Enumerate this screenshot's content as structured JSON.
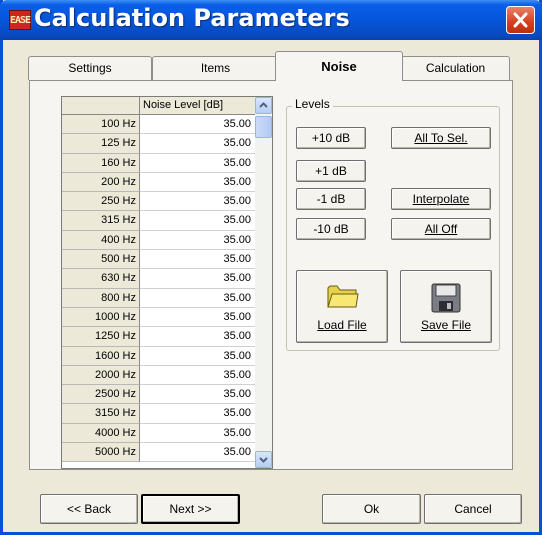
{
  "window": {
    "title": "Calculation Parameters"
  },
  "tabs": [
    {
      "label": "Settings"
    },
    {
      "label": "Items"
    },
    {
      "label": "Noise"
    },
    {
      "label": "Calculation"
    }
  ],
  "grid": {
    "column_header": "Noise Level [dB]",
    "rows": [
      {
        "freq": "100 Hz",
        "value": "35.00"
      },
      {
        "freq": "125 Hz",
        "value": "35.00"
      },
      {
        "freq": "160 Hz",
        "value": "35.00"
      },
      {
        "freq": "200 Hz",
        "value": "35.00"
      },
      {
        "freq": "250 Hz",
        "value": "35.00"
      },
      {
        "freq": "315 Hz",
        "value": "35.00"
      },
      {
        "freq": "400 Hz",
        "value": "35.00"
      },
      {
        "freq": "500 Hz",
        "value": "35.00"
      },
      {
        "freq": "630 Hz",
        "value": "35.00"
      },
      {
        "freq": "800 Hz",
        "value": "35.00"
      },
      {
        "freq": "1000 Hz",
        "value": "35.00"
      },
      {
        "freq": "1250 Hz",
        "value": "35.00"
      },
      {
        "freq": "1600 Hz",
        "value": "35.00"
      },
      {
        "freq": "2000 Hz",
        "value": "35.00"
      },
      {
        "freq": "2500 Hz",
        "value": "35.00"
      },
      {
        "freq": "3150 Hz",
        "value": "35.00"
      },
      {
        "freq": "4000 Hz",
        "value": "35.00"
      },
      {
        "freq": "5000 Hz",
        "value": "35.00"
      }
    ]
  },
  "levels": {
    "label": "Levels",
    "plus10": "+10 dB",
    "plus1": "+1 dB",
    "minus1": "-1 dB",
    "minus10": "-10 dB",
    "all_to_sel": "All To Sel.",
    "interpolate": "Interpolate",
    "all_off": "All Off",
    "load_file": "Load File",
    "save_file": "Save File"
  },
  "footer": {
    "back": "<< Back",
    "next": "Next >>",
    "ok": "Ok",
    "cancel": "Cancel"
  },
  "colors": {
    "titlebar": "#0654d6",
    "close_button": "#d2401e",
    "dialog_bg": "#ece9d8"
  }
}
